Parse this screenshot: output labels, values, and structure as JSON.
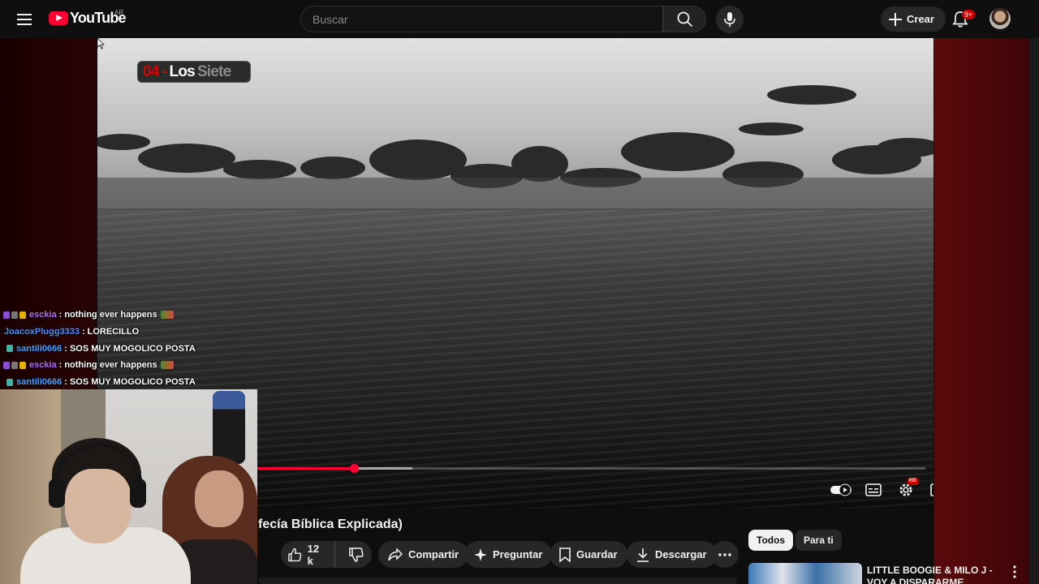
{
  "header": {
    "logo_text": "YouTube",
    "country_code": "AR",
    "search_placeholder": "Buscar",
    "create_label": "Crear",
    "notifications_badge": "9+",
    "icons": [
      "menu-icon",
      "search-icon",
      "microphone-icon",
      "plus-icon",
      "bell-icon"
    ]
  },
  "player": {
    "overlay_logo": {
      "number": "04 -",
      "word1": "Los",
      "word2": "Siete"
    },
    "progress": {
      "played_fraction": 0.31,
      "buffered_fraction": 0.38
    },
    "controls": [
      "autoplay-toggle",
      "subtitles-icon",
      "settings-icon",
      "miniplayer-icon",
      "cast-icon",
      "fullscreen-icon"
    ],
    "settings_badge": "HD"
  },
  "chat": [
    {
      "user": "esckia",
      "color": "#b46bf0",
      "message": "nothing ever happens",
      "badges": [
        "purple",
        "grey",
        "yellow"
      ],
      "emote": true
    },
    {
      "user": "JoacoxPlugg3333",
      "color": "#4f8cff",
      "message": "LORECILLO",
      "badges": [],
      "emote": false
    },
    {
      "user": "santili0666",
      "color": "#4f9eff",
      "message": "SOS MUY MOGOLICO POSTA",
      "badges": [
        "teal"
      ],
      "emote": false
    },
    {
      "user": "esckia",
      "color": "#b46bf0",
      "message": "nothing ever happens",
      "badges": [
        "purple",
        "grey",
        "yellow"
      ],
      "emote": true
    },
    {
      "user": "santili0666",
      "color": "#4f9eff",
      "message": "SOS MUY MOGOLICO POSTA",
      "badges": [
        "teal"
      ],
      "emote": false
    }
  ],
  "video": {
    "title_visible": "fecía Bíblica Explicada)",
    "likes": "12 k",
    "share_label": "Compartir",
    "ask_label": "Preguntar",
    "save_label": "Guardar",
    "download_label": "Descargar"
  },
  "sidebar": {
    "chips": [
      "Todos",
      "Para ti"
    ],
    "recommendation": {
      "title": "LITTLE BOOGIE & MILO J - VOY A DISPARARME (VIDEOCLIP"
    }
  }
}
